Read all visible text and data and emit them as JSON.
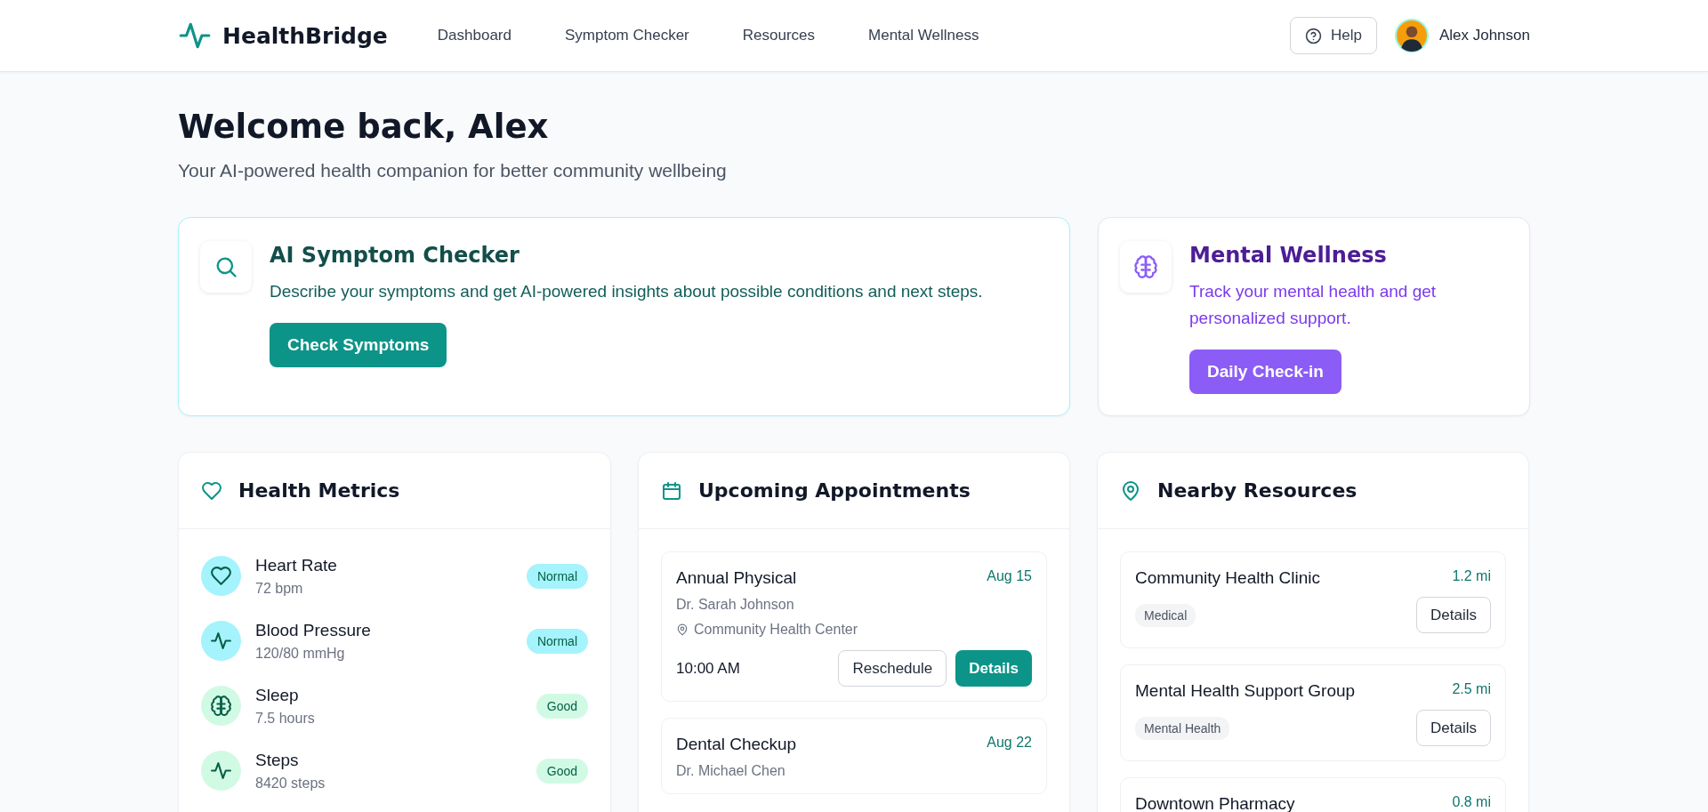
{
  "brand": "HealthBridge",
  "nav": [
    {
      "label": "Dashboard",
      "selected": false
    },
    {
      "label": "Symptom Checker",
      "selected": false
    },
    {
      "label": "Resources",
      "selected": false
    },
    {
      "label": "Mental Wellness",
      "selected": false
    }
  ],
  "help_button": "Help",
  "user": {
    "name": "Alex Johnson"
  },
  "welcome": {
    "title": "Welcome back, Alex",
    "subtitle": "Your AI-powered health companion for better community wellbeing"
  },
  "feature_cards": [
    {
      "kind": "symptom",
      "title": "AI Symptom Checker",
      "text": "Describe your symptoms and get AI-powered insights about possible conditions and next steps.",
      "button": "Check Symptoms"
    },
    {
      "kind": "wellness",
      "title": "Mental Wellness",
      "text": "Track your mental health and get personalized support.",
      "button": "Daily Check-in"
    }
  ],
  "health_metrics": {
    "title": "Health Metrics",
    "items": [
      {
        "kind": "heart",
        "name": "Heart Rate",
        "value": "72 bpm",
        "status": "Normal",
        "color": "#a5f3fc"
      },
      {
        "kind": "pulse",
        "name": "Blood Pressure",
        "value": "120/80 mmHg",
        "status": "Normal",
        "color": "#a5f3fc"
      },
      {
        "kind": "brain",
        "name": "Sleep",
        "value": "7.5 hours",
        "status": "Good",
        "color": "#d1fae5"
      },
      {
        "kind": "pulse",
        "name": "Steps",
        "value": "8420 steps",
        "status": "Good",
        "color": "#d1fae5"
      }
    ]
  },
  "appointments": {
    "title": "Upcoming Appointments",
    "items": [
      {
        "title": "Annual Physical",
        "date": "Aug 15",
        "doctor": "Dr. Sarah Johnson",
        "location": "Community Health Center",
        "time": "10:00 AM",
        "buttons": [
          "Reschedule",
          "Details"
        ]
      },
      {
        "title": "Dental Checkup",
        "date": "Aug 22",
        "doctor": "Dr. Michael Chen"
      }
    ]
  },
  "resources": {
    "title": "Nearby Resources",
    "items": [
      {
        "name": "Community Health Clinic",
        "distance": "1.2 mi",
        "tag": "Medical",
        "button": "Details"
      },
      {
        "name": "Mental Health Support Group",
        "distance": "2.5 mi",
        "tag": "Mental Health",
        "button": "Details"
      },
      {
        "name": "Downtown Pharmacy",
        "distance": "0.8 mi"
      }
    ]
  }
}
